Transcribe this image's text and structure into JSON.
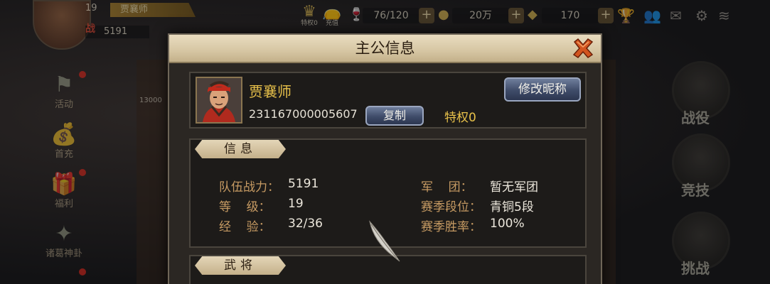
{
  "top_bar": {
    "player_level": "19",
    "player_name": "贾襄师",
    "power_glyph": "战",
    "power": "5191",
    "privilege_icon_label": "特权0",
    "recharge_icon_label": "充值",
    "stamina": "76/120",
    "coins": "20万",
    "gold": "170",
    "icons": [
      "crown-icon",
      "money-bag-icon",
      "cup-icon",
      "coin-icon",
      "ingot-icon",
      "trophy-icon",
      "friends-icon",
      "mail-icon",
      "gear-icon",
      "wifi-icon"
    ]
  },
  "side_menu": {
    "items": [
      {
        "label": "活动",
        "icon": "flag-icon"
      },
      {
        "label": "首充",
        "icon": "money-bag-icon"
      },
      {
        "label": "福利",
        "icon": "gift-icon"
      },
      {
        "label": "诸葛神卦",
        "icon": "fan-icon"
      }
    ]
  },
  "right_menu": {
    "items": [
      {
        "label": "战役"
      },
      {
        "label": "竞技"
      },
      {
        "label": "挑战"
      }
    ]
  },
  "background_stub": "13000",
  "dialog": {
    "title": "主公信息",
    "player": {
      "name": "贾襄师",
      "id": "231167000005607",
      "privilege": "特权0"
    },
    "buttons": {
      "rename": "修改昵称",
      "copy": "复制"
    },
    "info_section": {
      "title": "信息",
      "left": [
        {
          "label": "队伍战力：",
          "value": "5191"
        },
        {
          "label": "等    级：",
          "value": "19"
        },
        {
          "label": "经    验：",
          "value": "32/36"
        }
      ],
      "right": [
        {
          "label": "军    团：",
          "value": "暂无军团"
        },
        {
          "label": "赛季段位：",
          "value": "青铜5段"
        },
        {
          "label": "赛季胜率：",
          "value": "100%"
        }
      ]
    },
    "generals_section": {
      "title": "武将"
    }
  },
  "colors": {
    "gold_text": "#e8c14a",
    "label_text": "#c79b63",
    "button_blue": "#3f4c69",
    "header_parchment": "#d6c6a3"
  }
}
